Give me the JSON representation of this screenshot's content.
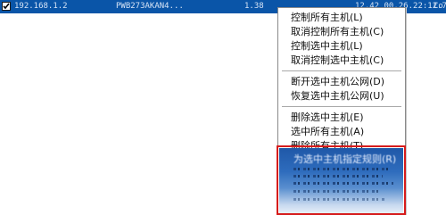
{
  "host_row": {
    "ip": "192.168.1.2",
    "computer_name": "PWB273AKAN4...",
    "version": "1.38",
    "time": "12.42 00.26.22:12.7",
    "extra": "Co"
  },
  "context_menu": {
    "items": [
      {
        "label": "控制所有主机(L)"
      },
      {
        "label": "取消控制所有主机(C)"
      },
      {
        "label": "控制选中主机(L)"
      },
      {
        "label": "取消控制选中主机(C)"
      },
      {
        "label": "断开选中主机公网(D)"
      },
      {
        "label": "恢复选中主机公网(U)"
      },
      {
        "label": "删除选中主机(E)"
      },
      {
        "label": "选中所有主机(A)"
      },
      {
        "label": "删除所有主机(T)"
      }
    ],
    "highlighted_item": {
      "label": "为选中主机指定规则(R)"
    }
  },
  "colors": {
    "row_selected": "#0a55a8",
    "highlight_border": "#d61b1b"
  }
}
